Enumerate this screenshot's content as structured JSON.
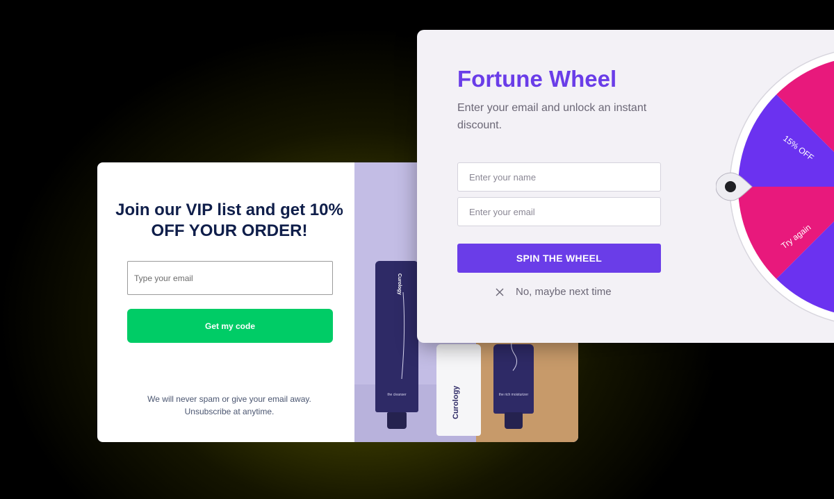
{
  "vip_popup": {
    "title": "Join our VIP list and get 10% OFF YOUR ORDER!",
    "email_placeholder": "Type your email",
    "button_label": "Get my code",
    "note_line1": "We will never spam or give your email away.",
    "note_line2": "Unsubscribe at anytime.",
    "colors": {
      "button": "#00cc66",
      "title": "#0f1e4a",
      "image_bg": "#c3bde5"
    },
    "product_image": {
      "brand": "Curology",
      "tube1_label": "the cleanser",
      "tube2_label": "the rich moisturizer"
    }
  },
  "fortune_wheel": {
    "title": "Fortune Wheel",
    "subtitle": "Enter your email and unlock an instant discount.",
    "name_placeholder": "Enter your name",
    "email_placeholder": "Enter your email",
    "button_label": "SPIN THE WHEEL",
    "dismiss_label": "No, maybe next time",
    "dismiss_icon": "close-icon",
    "segments": [
      "15% OFF",
      "Try again"
    ],
    "colors": {
      "accent": "#6a3de8",
      "segment_purple": "#6b32f0",
      "segment_pink": "#e8197c"
    }
  }
}
